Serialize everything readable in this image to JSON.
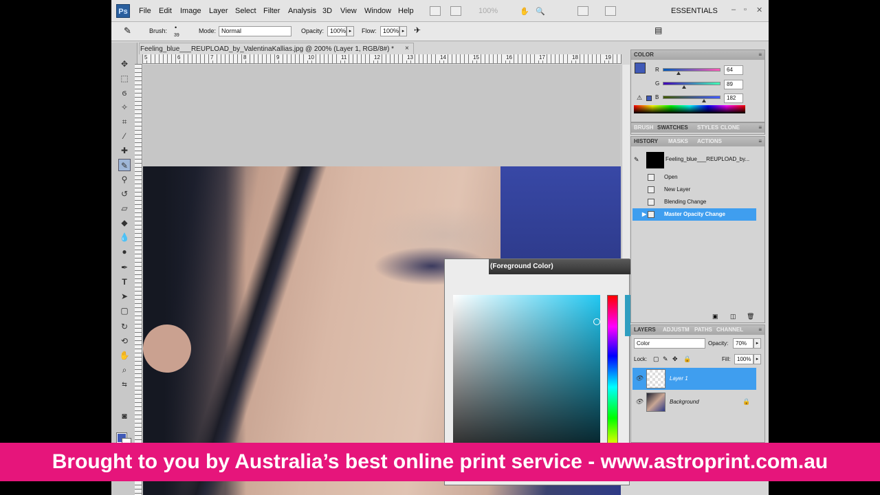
{
  "menubar": {
    "app_icon": "Ps",
    "items": [
      "File",
      "Edit",
      "Image",
      "Layer",
      "Select",
      "Filter",
      "Analysis",
      "3D",
      "View",
      "Window",
      "Help"
    ],
    "zoom": "100%",
    "workspace": "ESSENTIALS"
  },
  "options": {
    "brush_label": "Brush:",
    "brush_size": "39",
    "mode_label": "Mode:",
    "mode_value": "Normal",
    "opacity_label": "Opacity:",
    "opacity_value": "100%",
    "flow_label": "Flow:",
    "flow_value": "100%"
  },
  "document": {
    "tab_title": "Feeling_blue___REUPLOAD_by_ValentinaKallias.jpg @ 200% (Layer 1, RGB/8#) *",
    "close_glyph": "×",
    "ruler_numbers": [
      "5",
      "6",
      "7",
      "8",
      "9",
      "10",
      "11",
      "12",
      "13",
      "14",
      "15",
      "16",
      "17",
      "18",
      "19"
    ]
  },
  "picker": {
    "title": "(Foreground Color)"
  },
  "color_panel": {
    "tab": "COLOR",
    "foreground_hex": "#4059b6",
    "r_label": "R",
    "r_value": "64",
    "g_label": "G",
    "g_value": "89",
    "b_label": "B",
    "b_value": "182"
  },
  "swatch_tabs": [
    "BRUSH",
    "SWATCHES",
    "STYLES",
    "CLONE"
  ],
  "history_panel": {
    "tabs": [
      "HISTORY",
      "MASKS",
      "ACTIONS"
    ],
    "snapshot": "Feeling_blue___REUPLOAD_by...",
    "states": [
      "Open",
      "New Layer",
      "Blending Change",
      "Master Opacity Change"
    ]
  },
  "layers_panel": {
    "tabs": [
      "LAYERS",
      "ADJUSTM",
      "PATHS",
      "CHANNEL"
    ],
    "blend_mode": "Color",
    "opacity_label": "Opacity:",
    "opacity_value": "70%",
    "lock_label": "Lock:",
    "fill_label": "Fill:",
    "fill_value": "100%",
    "layers": [
      "Layer 1",
      "Background"
    ]
  },
  "banner": {
    "text": "Brought to you by Australia’s best online print service - www.astroprint.com.au",
    "color": "#e6157b"
  }
}
